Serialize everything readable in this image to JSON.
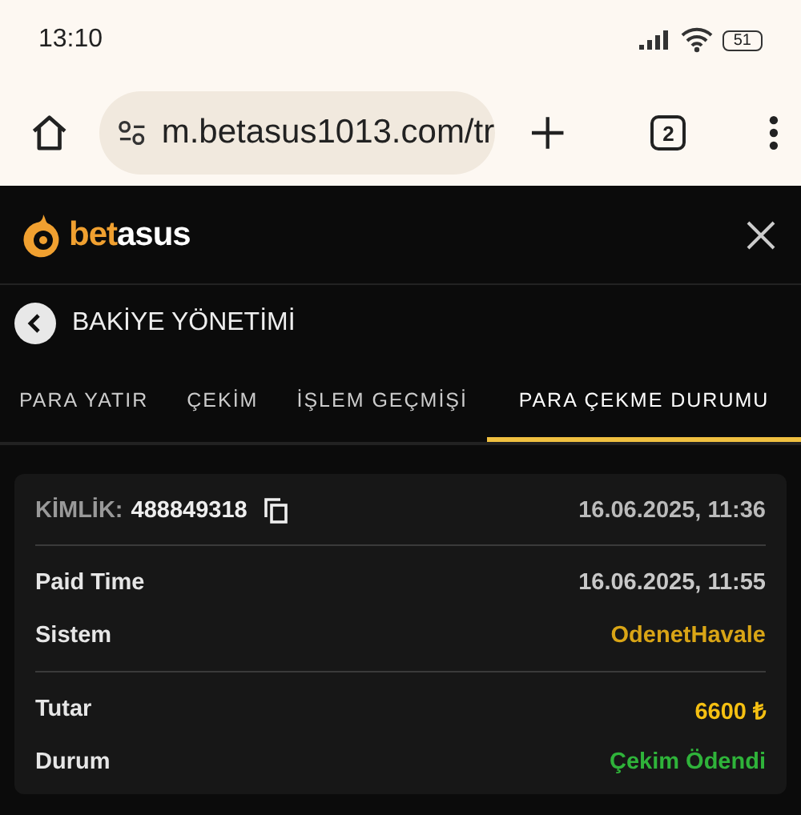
{
  "status_bar": {
    "time": "13:10",
    "battery": "51"
  },
  "browser": {
    "url": "m.betasus1013.com/tr",
    "tab_count": "2"
  },
  "header": {
    "logo": {
      "part_a": "bet",
      "part_b": "asus"
    }
  },
  "page": {
    "title": "BAKİYE YÖNETİMİ"
  },
  "tabs": [
    {
      "label": "PARA YATIR",
      "selected": false
    },
    {
      "label": "ÇEKİM",
      "selected": false
    },
    {
      "label": "İŞLEM GEÇMİŞİ",
      "selected": false
    },
    {
      "label": "PARA ÇEKME DURUMU",
      "selected": true
    }
  ],
  "card": {
    "id_label": "KİMLİK:",
    "id_value": "488849318",
    "date": "16.06.2025, 11:36",
    "sections": [
      [
        {
          "label": "Paid Time",
          "value": "16.06.2025, 11:55",
          "color": "#c8c8c8"
        },
        {
          "label": "Sistem",
          "value": "OdenetHavale",
          "color": "#d9a516"
        }
      ],
      [
        {
          "label": "Tutar",
          "value": "6600 ₺",
          "color": "#f5c012"
        },
        {
          "label": "Durum",
          "value": "Çekim Ödendi",
          "color": "#2fb33a"
        }
      ]
    ]
  }
}
